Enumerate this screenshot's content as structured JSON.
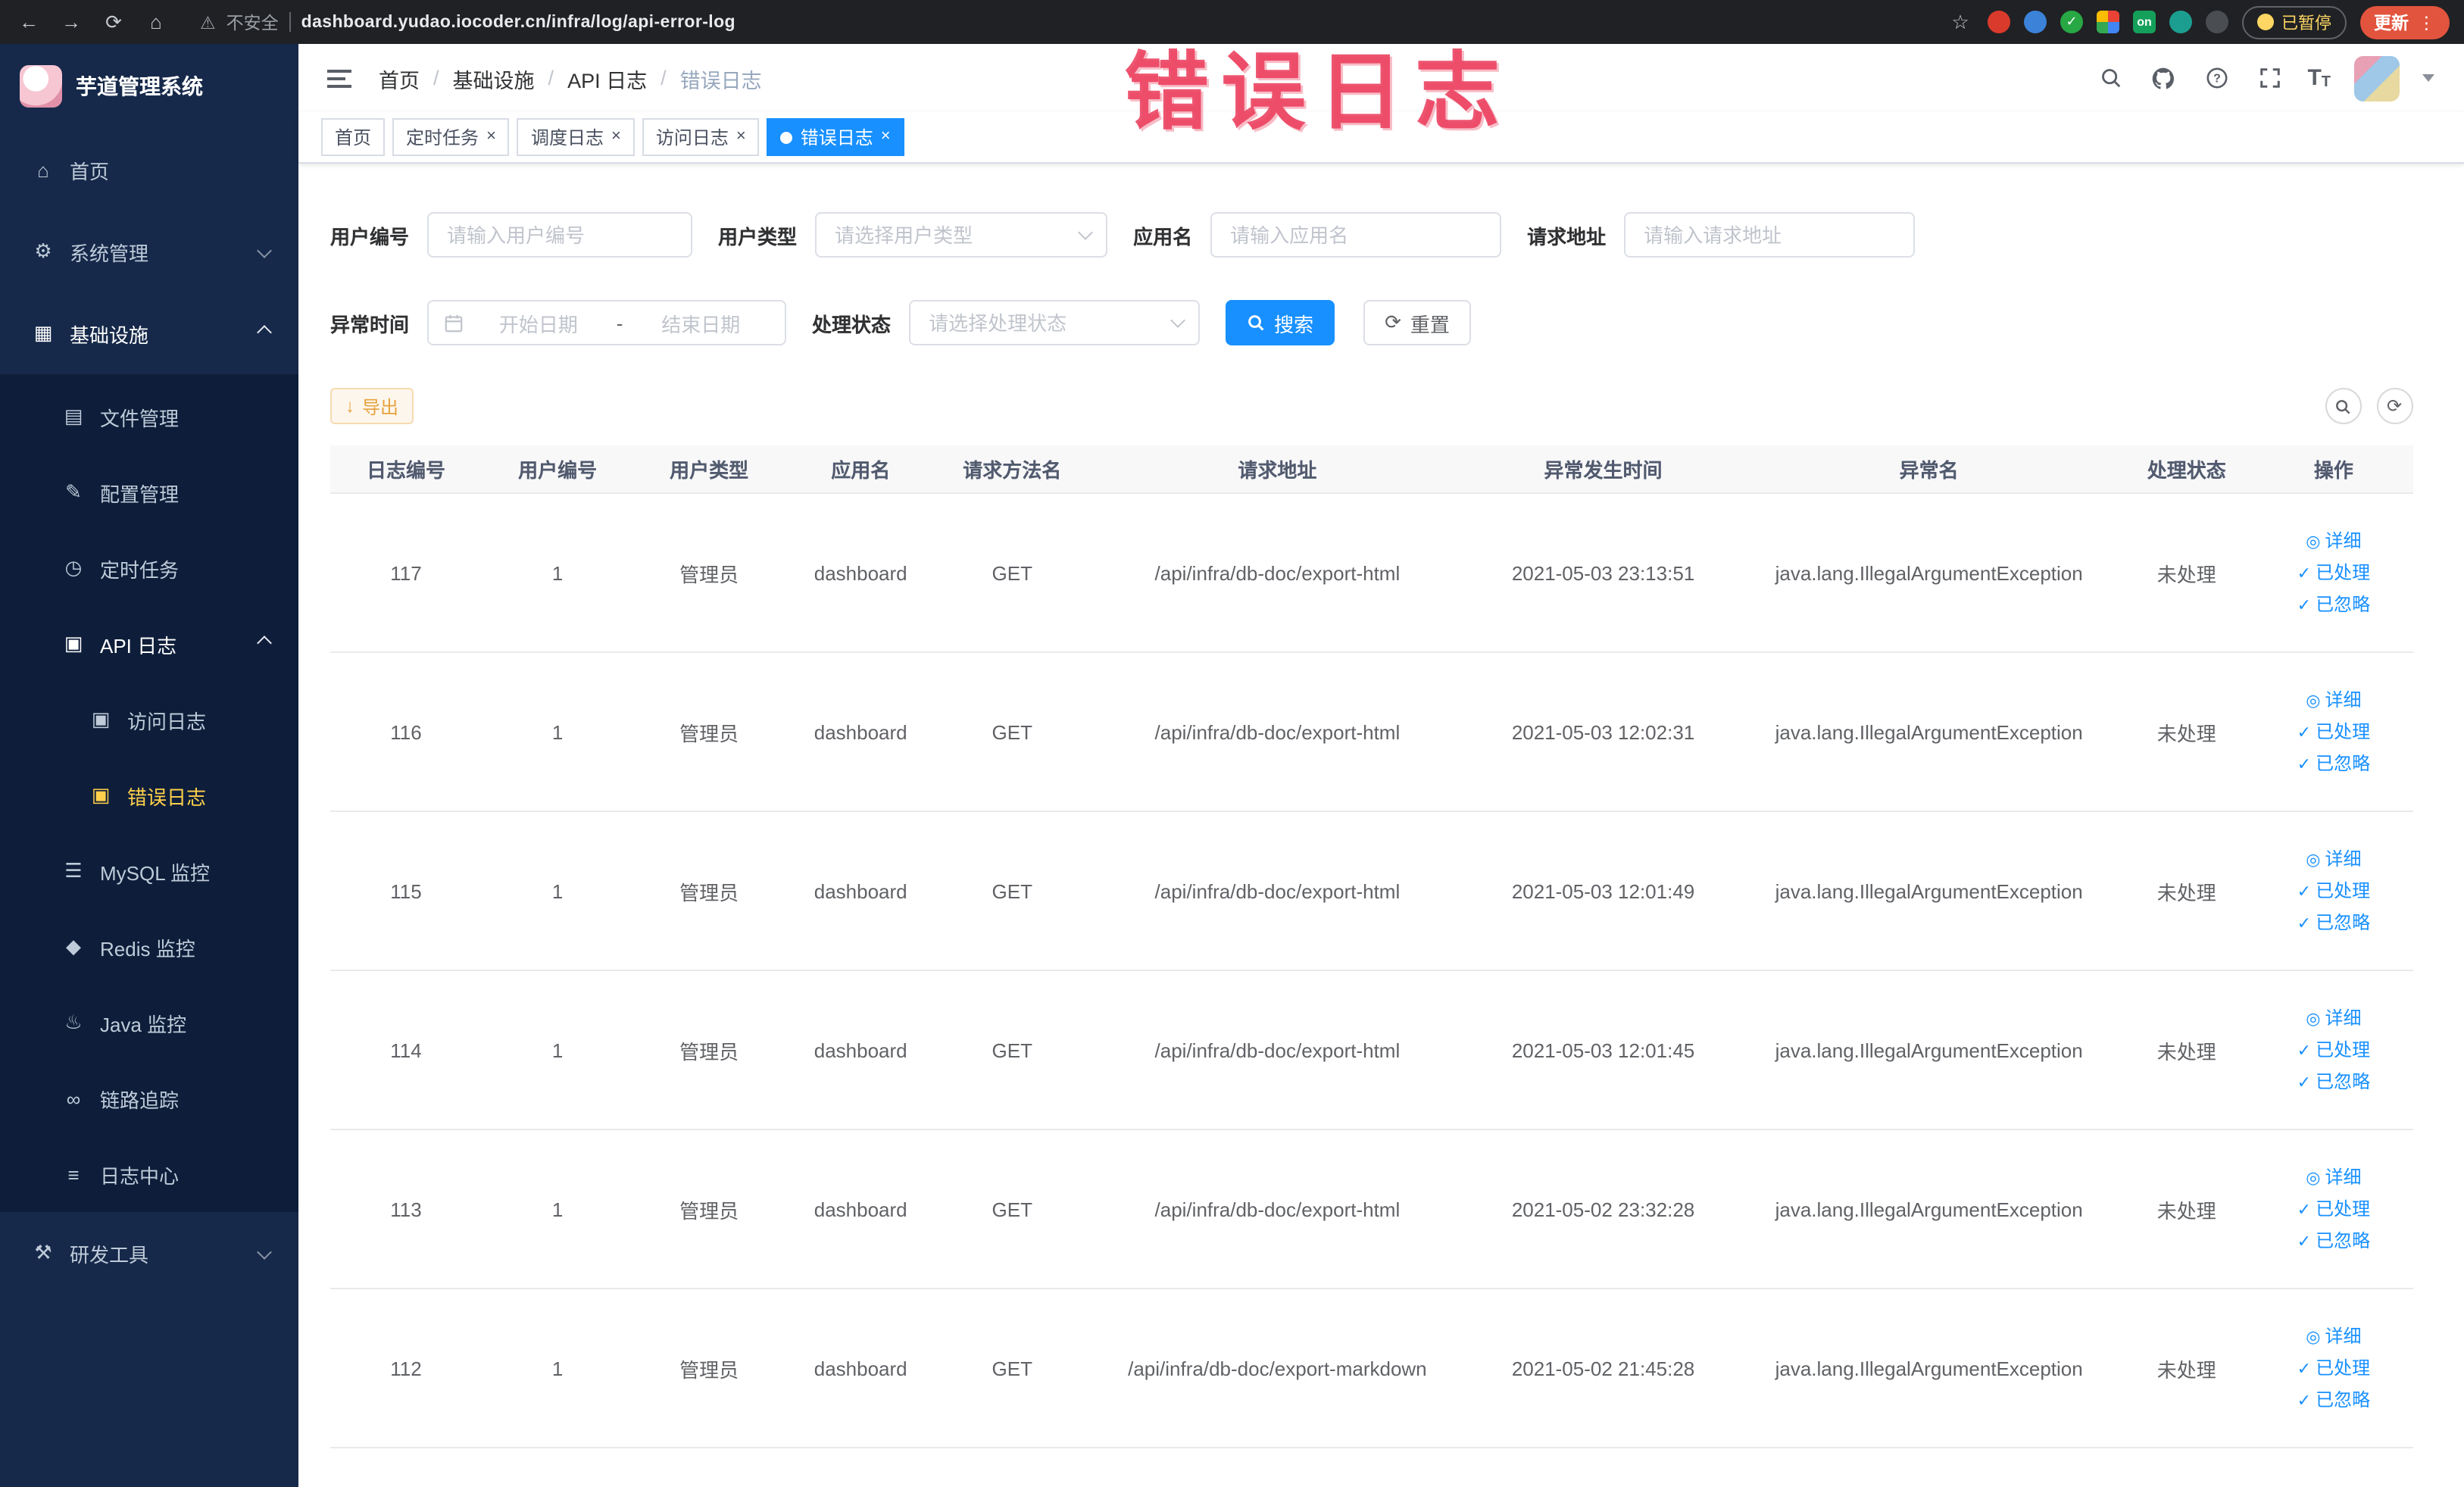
{
  "browser": {
    "security_label": "不安全",
    "url": "dashboard.yudao.iocoder.cn/infra/log/api-error-log",
    "paused_badge": "已暂停",
    "update_button": "更新",
    "extension_on_label": "on"
  },
  "annotation": "错误日志",
  "sidebar": {
    "logo_title": "芋道管理系统",
    "items": [
      {
        "label": "首页"
      },
      {
        "label": "系统管理"
      },
      {
        "label": "基础设施"
      },
      {
        "label": "文件管理"
      },
      {
        "label": "配置管理"
      },
      {
        "label": "定时任务"
      },
      {
        "label": "API 日志"
      },
      {
        "label": "访问日志"
      },
      {
        "label": "错误日志"
      },
      {
        "label": "MySQL 监控"
      },
      {
        "label": "Redis 监控"
      },
      {
        "label": "Java 监控"
      },
      {
        "label": "链路追踪"
      },
      {
        "label": "日志中心"
      },
      {
        "label": "研发工具"
      }
    ]
  },
  "breadcrumb": {
    "separator": "/",
    "items": [
      "首页",
      "基础设施",
      "API 日志",
      "错误日志"
    ]
  },
  "tabs": [
    {
      "label": "首页"
    },
    {
      "label": "定时任务"
    },
    {
      "label": "调度日志"
    },
    {
      "label": "访问日志"
    },
    {
      "label": "错误日志"
    }
  ],
  "filters": {
    "user_id_label": "用户编号",
    "user_id_placeholder": "请输入用户编号",
    "user_type_label": "用户类型",
    "user_type_placeholder": "请选择用户类型",
    "app_name_label": "应用名",
    "app_name_placeholder": "请输入应用名",
    "request_url_label": "请求地址",
    "request_url_placeholder": "请输入请求地址",
    "exception_time_label": "异常时间",
    "date_start_placeholder": "开始日期",
    "date_separator": "-",
    "date_end_placeholder": "结束日期",
    "process_status_label": "处理状态",
    "process_status_placeholder": "请选择处理状态",
    "search_button": "搜索",
    "reset_button": "重置"
  },
  "toolbar": {
    "export_button": "导出"
  },
  "table": {
    "columns": [
      "日志编号",
      "用户编号",
      "用户类型",
      "应用名",
      "请求方法名",
      "请求地址",
      "异常发生时间",
      "异常名",
      "处理状态",
      "操作"
    ],
    "rows": [
      {
        "id": "117",
        "user_id": "1",
        "user_type": "管理员",
        "app_name": "dashboard",
        "method": "GET",
        "url": "/api/infra/db-doc/export-html",
        "time": "2021-05-03 23:13:51",
        "exception": "java.lang.IllegalArgumentException",
        "status": "未处理"
      },
      {
        "id": "116",
        "user_id": "1",
        "user_type": "管理员",
        "app_name": "dashboard",
        "method": "GET",
        "url": "/api/infra/db-doc/export-html",
        "time": "2021-05-03 12:02:31",
        "exception": "java.lang.IllegalArgumentException",
        "status": "未处理"
      },
      {
        "id": "115",
        "user_id": "1",
        "user_type": "管理员",
        "app_name": "dashboard",
        "method": "GET",
        "url": "/api/infra/db-doc/export-html",
        "time": "2021-05-03 12:01:49",
        "exception": "java.lang.IllegalArgumentException",
        "status": "未处理"
      },
      {
        "id": "114",
        "user_id": "1",
        "user_type": "管理员",
        "app_name": "dashboard",
        "method": "GET",
        "url": "/api/infra/db-doc/export-html",
        "time": "2021-05-03 12:01:45",
        "exception": "java.lang.IllegalArgumentException",
        "status": "未处理"
      },
      {
        "id": "113",
        "user_id": "1",
        "user_type": "管理员",
        "app_name": "dashboard",
        "method": "GET",
        "url": "/api/infra/db-doc/export-html",
        "time": "2021-05-02 23:32:28",
        "exception": "java.lang.IllegalArgumentException",
        "status": "未处理"
      },
      {
        "id": "112",
        "user_id": "1",
        "user_type": "管理员",
        "app_name": "dashboard",
        "method": "GET",
        "url": "/api/infra/db-doc/export-markdown",
        "time": "2021-05-02 21:45:28",
        "exception": "java.lang.IllegalArgumentException",
        "status": "未处理"
      }
    ],
    "action_detail": "详细",
    "action_processed": "已处理",
    "action_ignored": "已忽略"
  },
  "icons": {
    "back": "←",
    "forward": "→",
    "reload": "⟳",
    "home": "⌂",
    "warning": "⚠",
    "star": "☆",
    "kebab": "⋮",
    "close": "×",
    "question": "?",
    "font_t": "T",
    "menu_home": "⌂",
    "menu_system": "⚙",
    "menu_infra": "▦",
    "menu_file": "▤",
    "menu_config": "✎",
    "menu_job": "◷",
    "menu_api_log": "▣",
    "menu_access_log": "▣",
    "menu_error_log": "▣",
    "menu_mysql": "☰",
    "menu_redis": "◆",
    "menu_java": "♨",
    "menu_trace": "∞",
    "menu_log_center": "≡",
    "menu_dev": "⚒",
    "refresh": "⟳",
    "download": "↓",
    "eye": "◎",
    "check": "✓",
    "columns": "▥"
  },
  "colors": {
    "primary": "#1890ff",
    "active_menu_text": "#ffd04b",
    "sidebar_bg": "#16294a",
    "submenu_bg": "#0e1e3a",
    "warning_button": "#e6a23c",
    "annotation_red": "#ea3e5c",
    "chrome_bg": "#202124",
    "update_button_bg": "#e2543e"
  }
}
